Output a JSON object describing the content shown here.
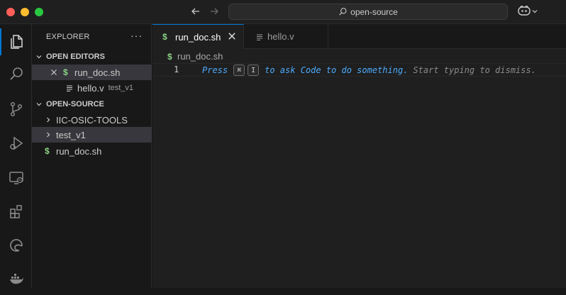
{
  "window": {
    "search_text": "open-source"
  },
  "activity_bar": {
    "items": [
      {
        "name": "explorer-icon",
        "active": true
      },
      {
        "name": "search-icon"
      },
      {
        "name": "source-control-icon"
      },
      {
        "name": "run-debug-icon"
      },
      {
        "name": "remote-explorer-icon"
      },
      {
        "name": "extensions-icon"
      },
      {
        "name": "edge-devtools-icon"
      },
      {
        "name": "docker-icon"
      }
    ]
  },
  "sidebar": {
    "title": "EXPLORER",
    "more": "···",
    "open_editors": {
      "label": "OPEN EDITORS",
      "items": [
        {
          "icon": "$",
          "name": "run_doc.sh",
          "desc": ""
        },
        {
          "icon": "lines",
          "name": "hello.v",
          "desc": "test_v1"
        }
      ]
    },
    "workspace": {
      "label": "OPEN-SOURCE",
      "items": [
        {
          "type": "folder",
          "name": "IIC-OSIC-TOOLS"
        },
        {
          "type": "folder",
          "name": "test_v1"
        },
        {
          "type": "file",
          "icon": "$",
          "name": "run_doc.sh"
        }
      ]
    }
  },
  "editor": {
    "tabs": [
      {
        "icon": "$",
        "label": "run_doc.sh",
        "active": true
      },
      {
        "icon": "lines",
        "label": "hello.v"
      }
    ],
    "breadcrumb": "run_doc.sh",
    "line_number": "1",
    "hint": {
      "press": "Press",
      "key1": "⌘",
      "key2": "I",
      "ask": "to ask Code to do something.",
      "dismiss": "Start typing to dismiss."
    }
  },
  "colors": {
    "accent": "#0078d4",
    "shell_icon": "#89d185",
    "hint_blue": "#4daafc"
  }
}
